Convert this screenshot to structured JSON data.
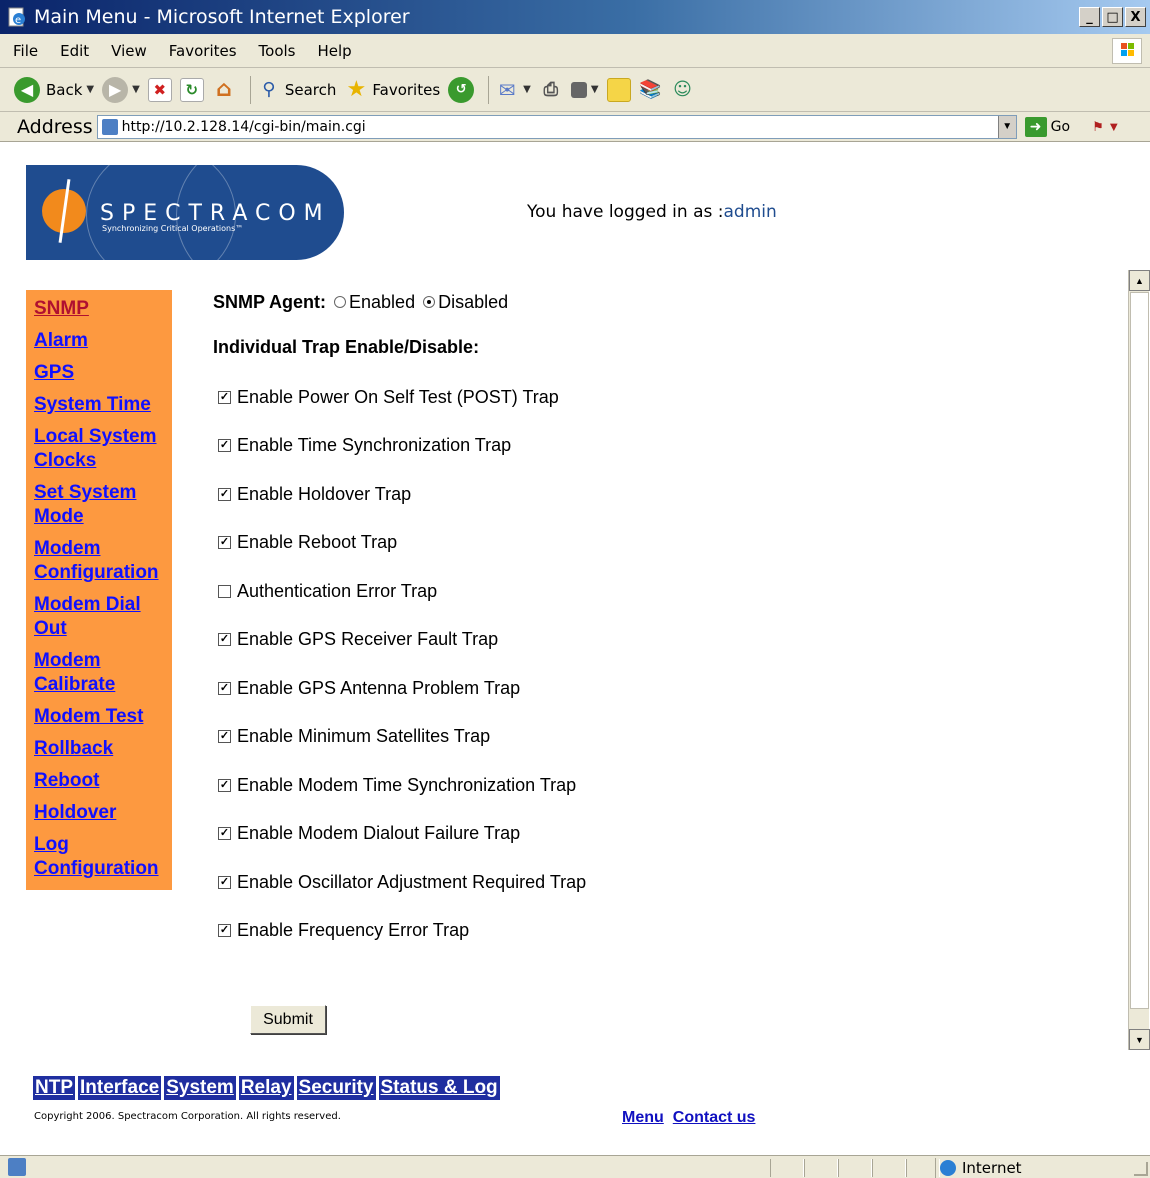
{
  "window": {
    "title": "Main Menu - Microsoft Internet Explorer",
    "controls": [
      "_",
      "□",
      "X"
    ]
  },
  "menubar": {
    "items": [
      "File",
      "Edit",
      "View",
      "Favorites",
      "Tools",
      "Help"
    ]
  },
  "toolbar": {
    "back_label": "Back",
    "search_label": "Search",
    "favorites_label": "Favorites"
  },
  "addressbar": {
    "label": "Address",
    "url": "http://10.2.128.14/cgi-bin/main.cgi",
    "go_label": "Go"
  },
  "header": {
    "brand": "SPECTRACOM",
    "tagline": "Synchronizing Critical Operations™",
    "login_prefix": "You have logged in as :",
    "login_user": "admin"
  },
  "leftnav": {
    "items": [
      {
        "label": "SNMP",
        "active": true
      },
      {
        "label": "Alarm"
      },
      {
        "label": "GPS"
      },
      {
        "label": "System Time"
      },
      {
        "label": "Local System Clocks"
      },
      {
        "label": "Set System Mode"
      },
      {
        "label": "Modem Configuration"
      },
      {
        "label": "Modem Dial Out"
      },
      {
        "label": "Modem Calibrate"
      },
      {
        "label": "Modem Test"
      },
      {
        "label": "Rollback"
      },
      {
        "label": "Reboot"
      },
      {
        "label": "Holdover"
      },
      {
        "label": "Log Configuration"
      }
    ]
  },
  "snmp": {
    "agent_label": "SNMP Agent:",
    "option_enabled": "Enabled",
    "option_disabled": "Disabled",
    "selected": "Disabled",
    "trap_heading": "Individual Trap Enable/Disable:",
    "traps": [
      {
        "label": "Enable Power On Self Test (POST) Trap",
        "checked": true
      },
      {
        "label": "Enable Time Synchronization Trap",
        "checked": true
      },
      {
        "label": "Enable Holdover Trap",
        "checked": true
      },
      {
        "label": "Enable Reboot Trap",
        "checked": true
      },
      {
        "label": "Authentication Error Trap",
        "checked": false
      },
      {
        "label": "Enable GPS Receiver Fault Trap",
        "checked": true
      },
      {
        "label": "Enable GPS Antenna Problem Trap",
        "checked": true
      },
      {
        "label": "Enable Minimum Satellites Trap",
        "checked": true
      },
      {
        "label": "Enable Modem Time Synchronization Trap",
        "checked": true
      },
      {
        "label": "Enable Modem Dialout Failure Trap",
        "checked": true
      },
      {
        "label": "Enable Oscillator Adjustment Required Trap",
        "checked": true
      },
      {
        "label": "Enable Frequency Error Trap",
        "checked": true
      }
    ],
    "submit_label": "Submit"
  },
  "bottomnav": {
    "items": [
      "NTP",
      "Interface",
      "System",
      "Relay",
      "Security",
      "Status & Log"
    ]
  },
  "footer": {
    "copyright": "Copyright 2006. Spectracom Corporation. All rights reserved.",
    "menu_link": "Menu",
    "contact_link": "Contact us"
  },
  "statusbar": {
    "zone": "Internet"
  },
  "colors": {
    "nav_bg": "#fd9940",
    "link": "#1010ff",
    "active_link": "#b01030",
    "bottomnav_bg": "#1f2ea0",
    "logo_bg": "#1f4c8f"
  }
}
